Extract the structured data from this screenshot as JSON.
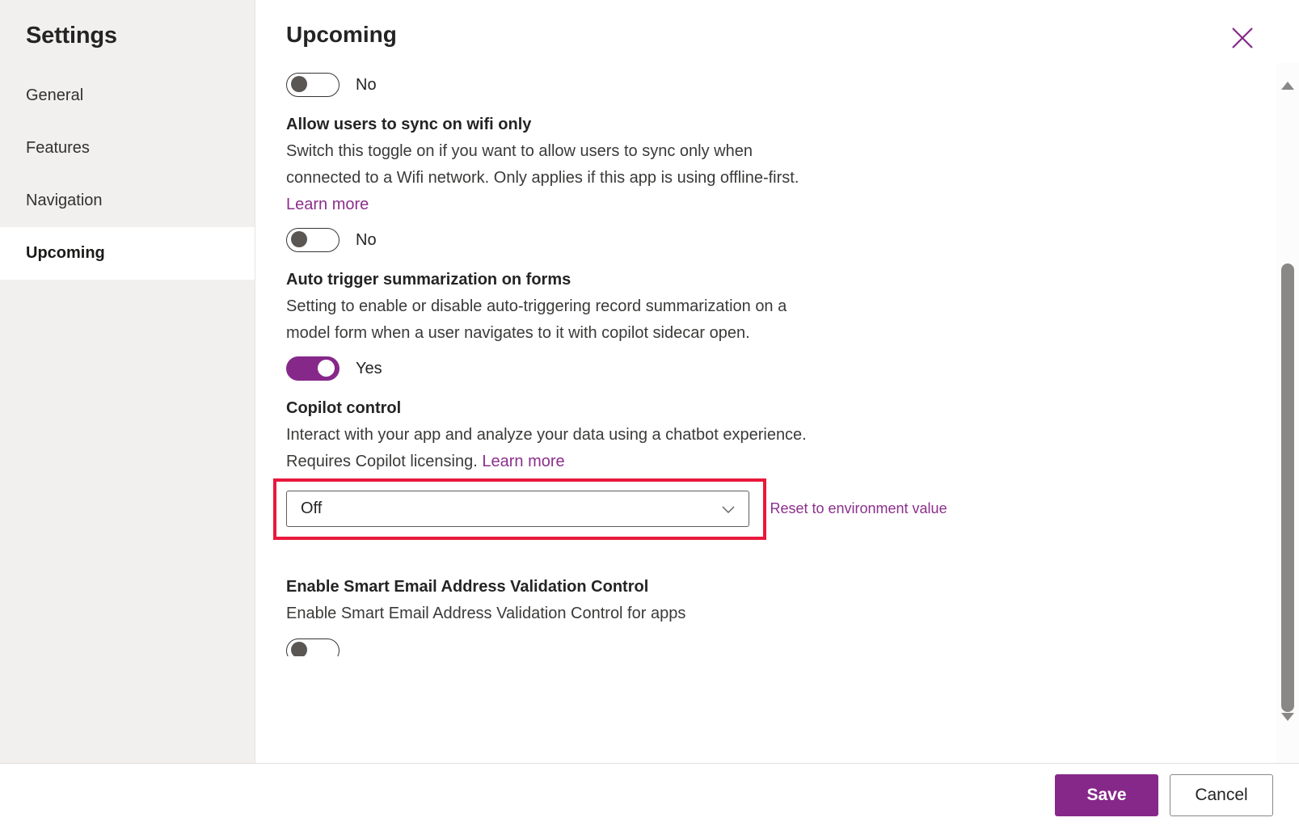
{
  "sidebar": {
    "title": "Settings",
    "items": [
      {
        "label": "General",
        "selected": false
      },
      {
        "label": "Features",
        "selected": false
      },
      {
        "label": "Navigation",
        "selected": false
      },
      {
        "label": "Upcoming",
        "selected": true
      }
    ]
  },
  "header": {
    "title": "Upcoming",
    "close_icon": "close-icon"
  },
  "settings": {
    "partial_top": {
      "toggle_value": "No",
      "toggle_state": "off"
    },
    "wifi_sync": {
      "title": "Allow users to sync on wifi only",
      "description": "Switch this toggle on if you want to allow users to sync only when connected to a Wifi network. Only applies if this app is using offline-first.",
      "link_label": "Learn more",
      "toggle_value": "No",
      "toggle_state": "off"
    },
    "auto_summarization": {
      "title": "Auto trigger summarization on forms",
      "description": "Setting to enable or disable auto-triggering record summarization on a model form when a user navigates to it with copilot sidecar open.",
      "toggle_value": "Yes",
      "toggle_state": "on"
    },
    "copilot_control": {
      "title": "Copilot control",
      "description": "Interact with your app and analyze your data using a chatbot experience. Requires Copilot licensing.",
      "link_label": "Learn more",
      "dropdown_value": "Off",
      "dropdown_options": [
        "Off"
      ],
      "reset_label": "Reset to environment value",
      "highlighted": true,
      "highlight_color": "#e8193c"
    },
    "smart_email": {
      "title": "Enable Smart Email Address Validation Control",
      "description": "Enable Smart Email Address Validation Control for apps"
    }
  },
  "scrollbar": {
    "up_icon": "triangle-up-icon",
    "down_icon": "triangle-down-icon",
    "thumb": "scroll-thumb"
  },
  "footer": {
    "save_label": "Save",
    "cancel_label": "Cancel"
  },
  "colors": {
    "accent": "#86288a",
    "link": "#8c2f8c",
    "highlight": "#e8193c",
    "sidebar_bg": "#f1f0ef"
  }
}
